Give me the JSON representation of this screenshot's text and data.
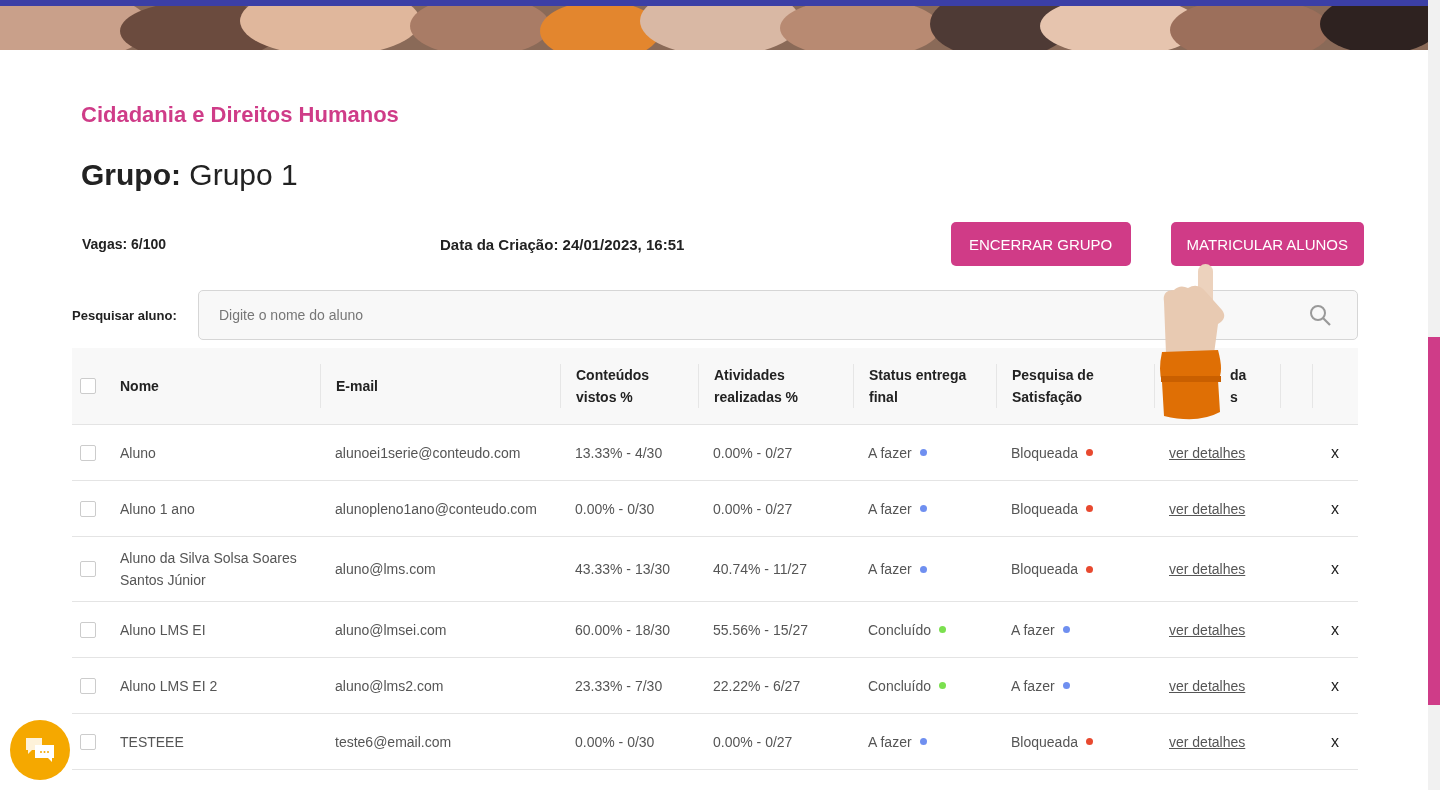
{
  "course_title": "Cidadania e Direitos Humanos",
  "group": {
    "label": "Grupo:",
    "name": "Grupo 1"
  },
  "info": {
    "vacancies": "Vagas: 6/100",
    "created_label": "Data da Criação:",
    "created_value": "24/01/2023, 16:51"
  },
  "buttons": [
    "ENCERRAR GRUPO",
    "MATRICULAR ALUNOS"
  ],
  "search": {
    "label": "Pesquisar aluno:",
    "placeholder": "Digite o nome do aluno"
  },
  "table": {
    "select_all_checked": false,
    "columns": [
      {
        "lines": [
          "Nome"
        ]
      },
      {
        "lines": [
          "E-mail"
        ]
      },
      {
        "lines": [
          "Conteúdos",
          "vistos %"
        ]
      },
      {
        "lines": [
          "Atividades",
          "realizadas %"
        ]
      },
      {
        "lines": [
          "Status entrega",
          "final"
        ]
      },
      {
        "lines": [
          "Pesquisa de",
          "Satisfação"
        ]
      },
      {
        "lines": [
          "da",
          "s"
        ]
      }
    ],
    "rows": [
      {
        "checked": false,
        "name": "Aluno",
        "email": "alunoei1serie@conteudo.com",
        "contents": "13.33% - 4/30",
        "activities": "0.00% - 0/27",
        "status": {
          "text": "A fazer",
          "color": "#6f8ff0"
        },
        "survey": {
          "text": "Bloqueada",
          "color": "#e8492f"
        },
        "link": "ver detalhes",
        "remove": "x"
      },
      {
        "checked": false,
        "name": "Aluno 1 ano",
        "email": "alunopleno1ano@conteudo.com",
        "contents": "0.00% - 0/30",
        "activities": "0.00% - 0/27",
        "status": {
          "text": "A fazer",
          "color": "#6f8ff0"
        },
        "survey": {
          "text": "Bloqueada",
          "color": "#e8492f"
        },
        "link": "ver detalhes",
        "remove": "x"
      },
      {
        "checked": false,
        "name": "Aluno da Silva Solsa Soares Santos Júnior",
        "email": "aluno@lms.com",
        "contents": "43.33% - 13/30",
        "activities": "40.74% - 11/27",
        "status": {
          "text": "A fazer",
          "color": "#6f8ff0"
        },
        "survey": {
          "text": "Bloqueada",
          "color": "#e8492f"
        },
        "link": "ver detalhes",
        "remove": "x"
      },
      {
        "checked": false,
        "name": "Aluno LMS EI",
        "email": "aluno@lmsei.com",
        "contents": "60.00% - 18/30",
        "activities": "55.56% - 15/27",
        "status": {
          "text": "Concluído",
          "color": "#7be04f"
        },
        "survey": {
          "text": "A fazer",
          "color": "#6f8ff0"
        },
        "link": "ver detalhes",
        "remove": "x"
      },
      {
        "checked": false,
        "name": "Aluno LMS EI 2",
        "email": "aluno@lms2.com",
        "contents": "23.33% - 7/30",
        "activities": "22.22% - 6/27",
        "status": {
          "text": "Concluído",
          "color": "#7be04f"
        },
        "survey": {
          "text": "A fazer",
          "color": "#6f8ff0"
        },
        "link": "ver detalhes",
        "remove": "x"
      },
      {
        "checked": false,
        "name": "TESTEEE",
        "email": "teste6@email.com",
        "contents": "0.00% - 0/30",
        "activities": "0.00% - 0/27",
        "status": {
          "text": "A fazer",
          "color": "#6f8ff0"
        },
        "survey": {
          "text": "Bloqueada",
          "color": "#e8492f"
        },
        "link": "ver detalhes",
        "remove": "x"
      }
    ]
  }
}
